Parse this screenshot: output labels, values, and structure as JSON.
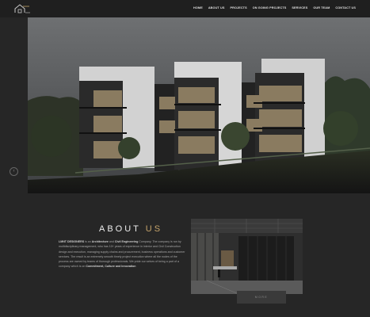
{
  "header": {
    "logo_name": "home-logo-icon",
    "nav": [
      "HOME",
      "ABOUT US",
      "PROJECTS",
      "ON GOING PROJECTS",
      "SERVICES",
      "OUR TEAM",
      "CONTACT US"
    ]
  },
  "hero": {
    "prev_arrow": "‹"
  },
  "about": {
    "title_main": "ABOUT ",
    "title_accent": "US",
    "p1": "LMNT DESIGNERS",
    "p2": " is an ",
    "p3": "Architecture",
    "p4": " and ",
    "p5": "Civil Engineering",
    "p6": " Company. The company is run by multidisciplinary management, who has 10+ years of experience in interior and Civil Construction design and execution, managing supply chains and procurement, business operations and customer services. The result is an extremely smooth timely project execution where all the nodes of the process are owned by teams of thorough professionals. We pride our selves of being a part of a company which is on ",
    "p7": "Commitment, Culture and Innovation",
    "more_label": "MORE"
  },
  "colors": {
    "accent": "#c4a36a",
    "background": "#262626",
    "header": "#1f1f1f"
  }
}
